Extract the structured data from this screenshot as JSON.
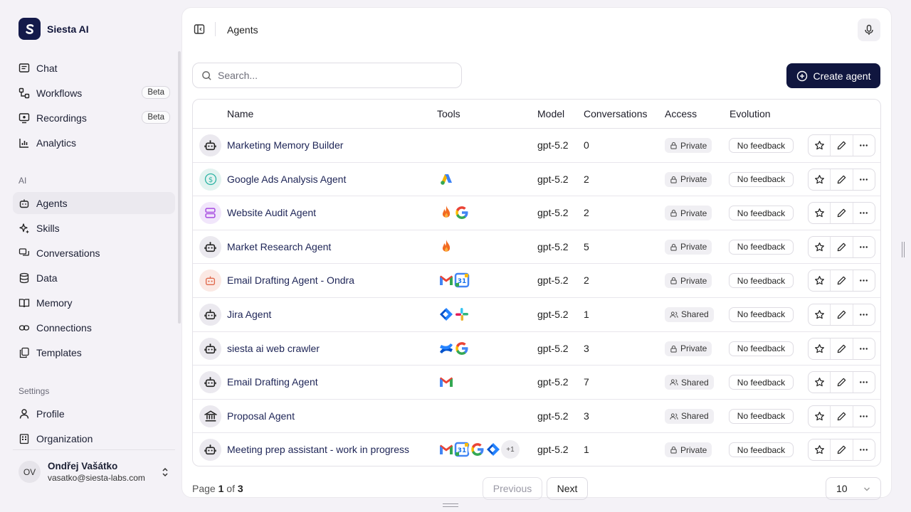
{
  "brand": {
    "name": "Siesta AI"
  },
  "sidebar": {
    "items": [
      {
        "label": "Chat"
      },
      {
        "label": "Workflows",
        "badge": "Beta"
      },
      {
        "label": "Recordings",
        "badge": "Beta"
      },
      {
        "label": "Analytics"
      }
    ],
    "ai_label": "AI",
    "ai_items": [
      {
        "label": "Agents"
      },
      {
        "label": "Skills"
      },
      {
        "label": "Conversations"
      },
      {
        "label": "Data"
      },
      {
        "label": "Memory"
      },
      {
        "label": "Connections"
      },
      {
        "label": "Templates"
      }
    ],
    "settings_label": "Settings",
    "settings_items": [
      {
        "label": "Profile"
      },
      {
        "label": "Organization"
      }
    ],
    "user": {
      "initials": "OV",
      "name": "Ondřej Vašátko",
      "email": "vasatko@siesta-labs.com"
    }
  },
  "header": {
    "title": "Agents"
  },
  "search": {
    "placeholder": "Search..."
  },
  "create_button": "Create agent",
  "table": {
    "columns": [
      "Name",
      "Tools",
      "Model",
      "Conversations",
      "Access",
      "Evolution"
    ],
    "rows": [
      {
        "name": "Marketing Memory Builder",
        "model": "gpt-5.2",
        "conversations": "0",
        "access": "Private",
        "evolution": "No feedback"
      },
      {
        "name": "Google Ads Analysis Agent",
        "model": "gpt-5.2",
        "conversations": "2",
        "access": "Private",
        "evolution": "No feedback"
      },
      {
        "name": "Website Audit Agent",
        "model": "gpt-5.2",
        "conversations": "2",
        "access": "Private",
        "evolution": "No feedback"
      },
      {
        "name": "Market Research Agent",
        "model": "gpt-5.2",
        "conversations": "5",
        "access": "Private",
        "evolution": "No feedback"
      },
      {
        "name": "Email Drafting Agent - Ondra",
        "model": "gpt-5.2",
        "conversations": "2",
        "access": "Private",
        "evolution": "No feedback"
      },
      {
        "name": "Jira Agent",
        "model": "gpt-5.2",
        "conversations": "1",
        "access": "Shared",
        "evolution": "No feedback"
      },
      {
        "name": "siesta ai web crawler",
        "model": "gpt-5.2",
        "conversations": "3",
        "access": "Private",
        "evolution": "No feedback"
      },
      {
        "name": "Email Drafting Agent",
        "model": "gpt-5.2",
        "conversations": "7",
        "access": "Shared",
        "evolution": "No feedback"
      },
      {
        "name": "Proposal Agent",
        "model": "gpt-5.2",
        "conversations": "3",
        "access": "Shared",
        "evolution": "No feedback"
      },
      {
        "name": "Meeting prep assistant - work in progress",
        "model": "gpt-5.2",
        "conversations": "1",
        "access": "Private",
        "evolution": "No feedback",
        "more_tools": "+1"
      }
    ]
  },
  "pagination": {
    "page_prefix": "Page",
    "current": "1",
    "of": "of",
    "total": "3",
    "previous": "Previous",
    "next": "Next",
    "page_size": "10"
  }
}
